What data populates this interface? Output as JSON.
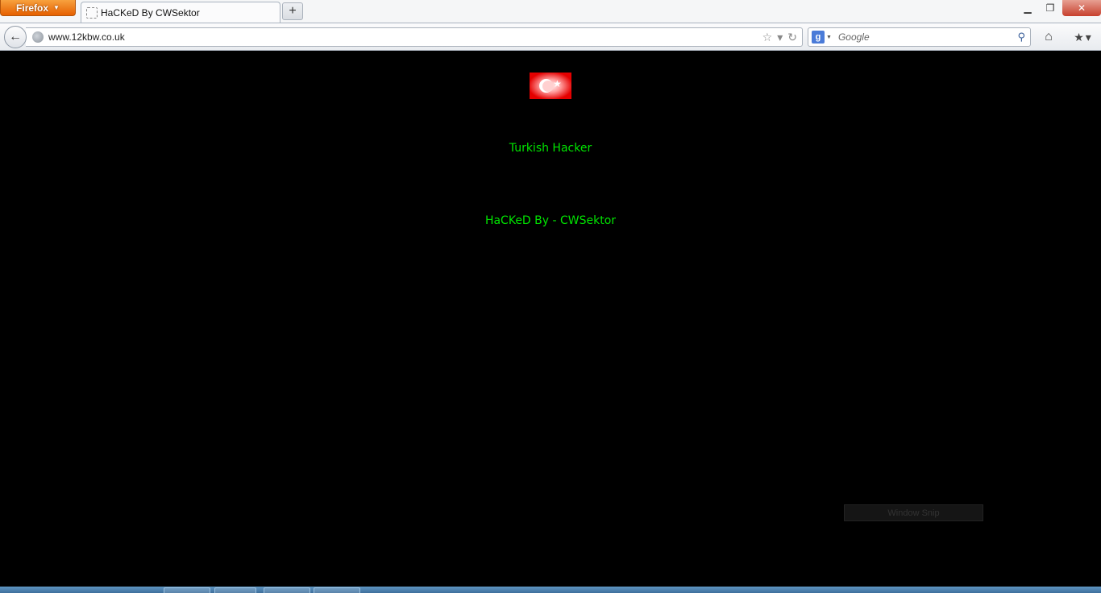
{
  "browser": {
    "menu_button_label": "Firefox",
    "tab_title": "HaCKeD By CWSektor",
    "new_tab_symbol": "+",
    "url": "www.12kbw.co.uk",
    "search_placeholder": "Google",
    "window_controls": {
      "minimize": "▁",
      "restore": "❐",
      "close": "✕"
    }
  },
  "page": {
    "background_color": "#000000",
    "text_color": "#00e500",
    "lines": [
      "Turkish Hacker",
      "HaCKeD By - CWSektor"
    ]
  },
  "overlay": {
    "snip_label": "Window Snip"
  }
}
